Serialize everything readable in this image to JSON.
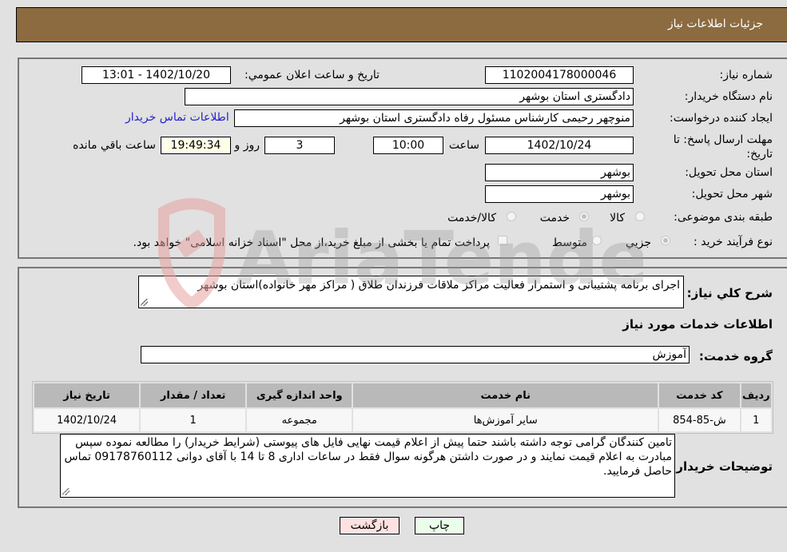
{
  "header": {
    "title": "جزئیات اطلاعات نیاز"
  },
  "fields": {
    "need_number": {
      "label": "شماره نیاز:",
      "value": "1102004178000046"
    },
    "announce": {
      "label": "تاريخ و ساعت اعلان عمومي:",
      "value": "1402/10/20 - 13:01"
    },
    "buyer_org": {
      "label": "نام دستگاه خريدار:",
      "value": "دادگستری استان بوشهر"
    },
    "creator": {
      "label": "ايجاد کننده درخواست:",
      "value": "منوچهر رحیمی کارشناس مسئول رفاه دادگستری استان بوشهر"
    },
    "contact_link": "اطلاعات تماس خريدار",
    "deadline": {
      "label": "مهلت ارسال پاسخ: تا تاريخ:",
      "date": "1402/10/24",
      "time_label": "ساعت",
      "time": "10:00",
      "days": "3",
      "days_label": "روز و",
      "remaining": "19:49:34",
      "remaining_label": "ساعت باقي مانده"
    },
    "province": {
      "label": "استان محل تحويل:",
      "value": "بوشهر"
    },
    "city": {
      "label": "شهر محل تحويل:",
      "value": "بوشهر"
    },
    "category": {
      "label": "طبقه بندی موضوعی:",
      "options": [
        {
          "label": "کالا",
          "checked": false
        },
        {
          "label": "خدمت",
          "checked": true
        },
        {
          "label": "کالا/خدمت",
          "checked": false
        }
      ]
    },
    "process": {
      "label": "نوع فرآیند خرید :",
      "options": [
        {
          "label": "جزيي",
          "checked": true
        },
        {
          "label": "متوسط",
          "checked": false
        }
      ],
      "treasury_note": "پرداخت تمام یا بخشی از مبلغ خرید،از محل \"اسناد خزانه اسلامی\" خواهد بود.",
      "treasury_checked": false
    }
  },
  "description": {
    "label": "شرح کلي نياز:",
    "value": "اجرای برنامه پشتیبانی و استمرار فعالیت مراکز ملاقات فرزندان طلاق ( مراکز مهر خانواده)استان بوشهر"
  },
  "services": {
    "section_title": "اطلاعات خدمات مورد نياز",
    "group_label": "گروه خدمت:",
    "group_value": "آموزش",
    "table": {
      "headers": [
        "رديف",
        "کد خدمت",
        "نام خدمت",
        "واحد اندازه گيری",
        "تعداد / مقدار",
        "تاريخ نياز"
      ],
      "rows": [
        [
          "1",
          "ش-85-854",
          "سایر آموزش‌ها",
          "مجموعه",
          "1",
          "1402/10/24"
        ]
      ]
    }
  },
  "buyer_notes": {
    "label": "توضيحات خريدار:",
    "value": "تامین کنندگان گرامی توجه داشته باشند حتما پیش از اعلام قیمت نهایی فایل های پیوستی (شرایط خریدار) را مطالعه نموده سپس مبادرت به اعلام قیمت نمایند و در صورت داشتن هرگونه سوال فقط در ساعات اداری 8 تا 14 با آقای دوانی 09178760112 تماس حاصل فرمایید."
  },
  "buttons": {
    "print": "چاپ",
    "back": "بازگشت"
  },
  "colors": {
    "header_bg": "#8c6b40",
    "print_bg": "#eaffea",
    "back_bg": "#ffe1e1",
    "link": "#2424c8"
  }
}
